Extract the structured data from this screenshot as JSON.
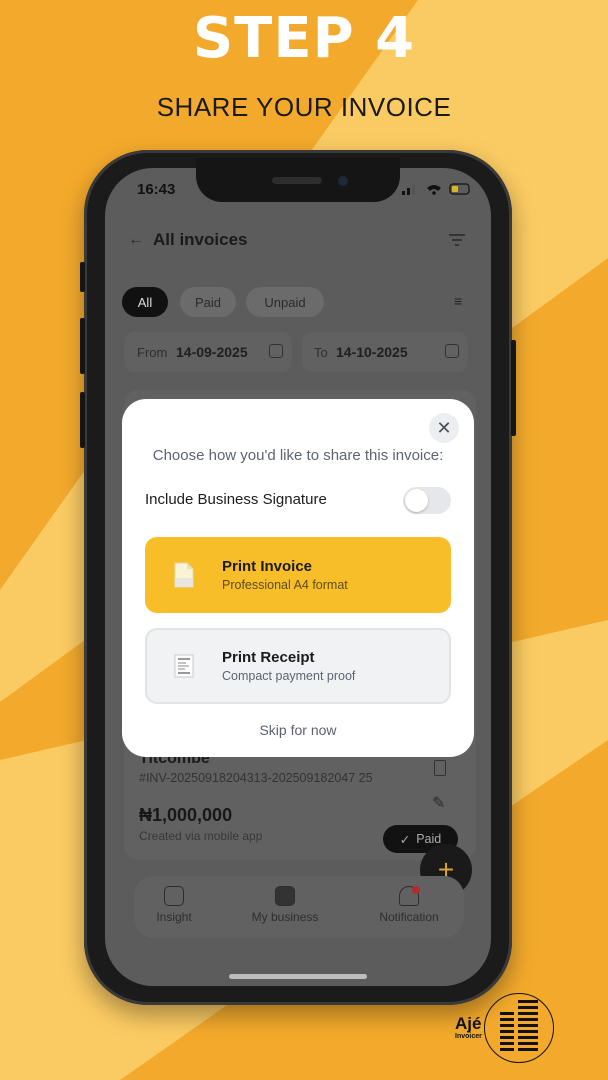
{
  "promo": {
    "headline": "STEP 4",
    "subline": "SHARE YOUR INVOICE",
    "brand": "Ajé",
    "brand_sub": "Invoicer"
  },
  "status_bar": {
    "time": "16:43"
  },
  "header": {
    "title": "All invoices"
  },
  "filters": {
    "chips": [
      "All",
      "Paid",
      "Unpaid"
    ],
    "selected": "All",
    "from_label": "From",
    "from_value": "14-09-2025",
    "to_label": "To",
    "to_value": "14-10-2025"
  },
  "invoice_card": {
    "client": "Titcombe",
    "number": "#INV-20250918204313-202509182047 25",
    "amount": "₦1,000,000",
    "created": "Created via mobile app",
    "status": "Paid"
  },
  "bottom_nav": {
    "items": [
      {
        "label": "Insight",
        "icon": "chart-icon"
      },
      {
        "label": "My business",
        "icon": "business-card-icon"
      },
      {
        "label": "Notification",
        "icon": "bell-icon"
      }
    ]
  },
  "share_modal": {
    "prompt": "Choose how you'd like to share this invoice:",
    "signature_label": "Include Business Signature",
    "signature_enabled": false,
    "options": [
      {
        "title": "Print Invoice",
        "subtitle": "Professional A4 format",
        "highlighted": true
      },
      {
        "title": "Print Receipt",
        "subtitle": "Compact payment proof",
        "highlighted": false
      }
    ],
    "skip_label": "Skip for now"
  },
  "colors": {
    "background": "#F3AA2C",
    "stripe": "#FBCB63",
    "accent": "#F8BE2A"
  }
}
